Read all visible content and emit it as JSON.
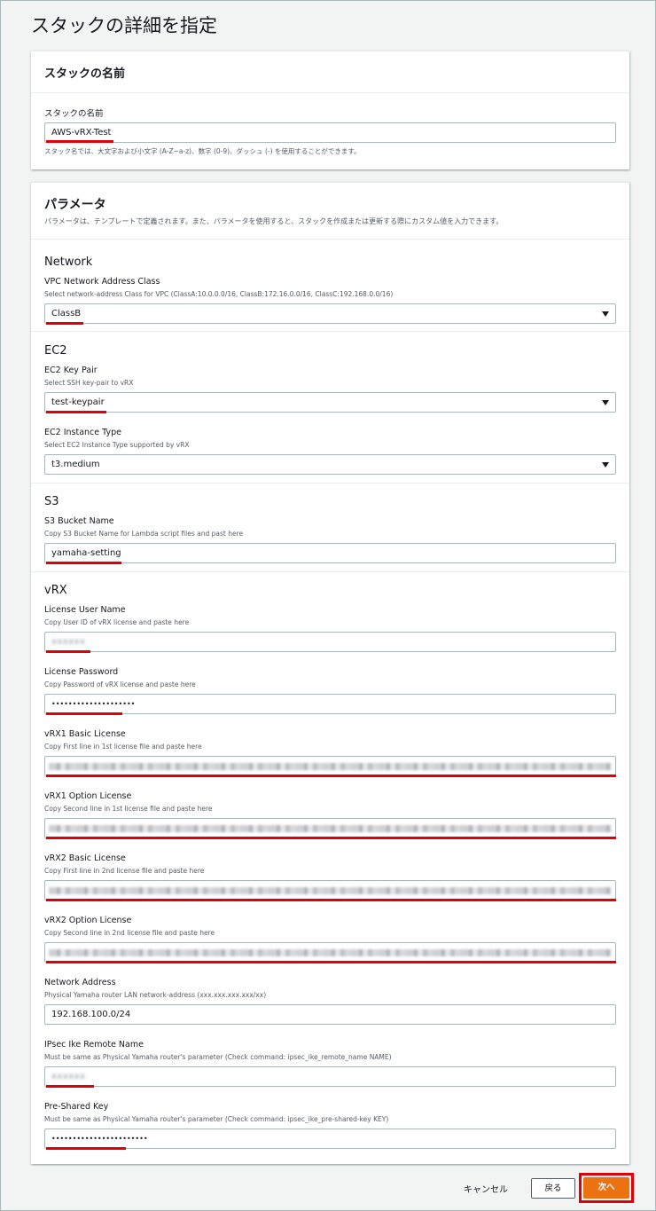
{
  "page_title": "スタックの詳細を指定",
  "stack_name_panel": {
    "title": "スタックの名前",
    "field_label": "スタックの名前",
    "value": "AWS-vRX-Test",
    "hint": "スタック名では、大文字および小文字 (A-Z~a-z)、数字 (0-9)、ダッシュ (-) を使用することができます。"
  },
  "params_panel": {
    "title": "パラメータ",
    "description": "パラメータは、テンプレートで定義されます。また、パラメータを使用すると、スタックを作成または更新する際にカスタム値を入力できます。",
    "network": {
      "section": "Network",
      "vpc_label": "VPC Network Address Class",
      "vpc_hint": "Select network-address Class for VPC (ClassA:10.0.0.0/16, ClassB:172.16.0.0/16, ClassC:192.168.0.0/16)",
      "vpc_value": "ClassB"
    },
    "ec2": {
      "section": "EC2",
      "keypair_label": "EC2 Key Pair",
      "keypair_hint": "Select SSH key-pair to vRX",
      "keypair_value": "test-keypair",
      "instance_label": "EC2 Instance Type",
      "instance_hint": "Select EC2 Instance Type supported by vRX",
      "instance_value": "t3.medium"
    },
    "s3": {
      "section": "S3",
      "bucket_label": "S3 Bucket Name",
      "bucket_hint": "Copy S3 Bucket Name for Lambda script files and past here",
      "bucket_value": "yamaha-setting"
    },
    "vrx": {
      "section": "vRX",
      "user_label": "License User Name",
      "user_hint": "Copy User ID of vRX license and paste here",
      "user_value": "xxxxxx",
      "password_label": "License Password",
      "password_hint": "Copy Password of vRX license and paste here",
      "password_value": "••••••••••••••••••••",
      "vrx1_basic_label": "vRX1 Basic License",
      "vrx1_basic_hint": "Copy First line in 1st license file and paste here",
      "vrx1_option_label": "vRX1 Option License",
      "vrx1_option_hint": "Copy Second line in 1st license file and paste here",
      "vrx2_basic_label": "vRX2 Basic License",
      "vrx2_basic_hint": "Copy First line in 2nd license file and paste here",
      "vrx2_option_label": "vRX2 Option License",
      "vrx2_option_hint": "Copy Second line in 2nd license file and paste here",
      "netaddr_label": "Network Address",
      "netaddr_hint": "Physical Yamaha router LAN network-address (xxx.xxx.xxx.xxx/xx)",
      "netaddr_value": "192.168.100.0/24",
      "ike_label": "IPsec Ike Remote Name",
      "ike_hint": "Must be same as Physical Yamaha router's parameter (Check command: ipsec_ike_remote_name NAME)",
      "ike_value": "xxxxxx",
      "psk_label": "Pre-Shared Key",
      "psk_hint": "Must be same as Physical Yamaha router's parameter (Check command: ipsec_ike_pre-shared-key KEY)",
      "psk_value": "•••••••••••••••••••••••"
    }
  },
  "footer": {
    "cancel": "キャンセル",
    "back": "戻る",
    "next": "次へ"
  },
  "colors": {
    "primary_button": "#ec7211",
    "highlight": "#e0000a"
  }
}
